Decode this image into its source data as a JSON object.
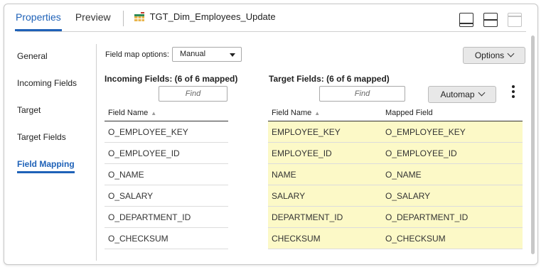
{
  "tabs": [
    {
      "label": "Properties",
      "active": true
    },
    {
      "label": "Preview",
      "active": false
    }
  ],
  "object_title": "TGT_Dim_Employees_Update",
  "nav": [
    {
      "label": "General",
      "active": false
    },
    {
      "label": "Incoming Fields",
      "active": false
    },
    {
      "label": "Target",
      "active": false
    },
    {
      "label": "Target Fields",
      "active": false
    },
    {
      "label": "Field Mapping",
      "active": true
    }
  ],
  "field_map_options": {
    "label": "Field map options:",
    "value": "Manual"
  },
  "options_button": "Options",
  "incoming": {
    "title": "Incoming Fields: (6 of 6 mapped)",
    "find_placeholder": "Find",
    "header": "Field Name",
    "rows": [
      "O_EMPLOYEE_KEY",
      "O_EMPLOYEE_ID",
      "O_NAME",
      "O_SALARY",
      "O_DEPARTMENT_ID",
      "O_CHECKSUM"
    ]
  },
  "target": {
    "title": "Target Fields: (6 of 6 mapped)",
    "find_placeholder": "Find",
    "automap_label": "Automap",
    "headers": {
      "field": "Field Name",
      "mapped": "Mapped Field"
    },
    "rows": [
      {
        "field": "EMPLOYEE_KEY",
        "mapped": "O_EMPLOYEE_KEY"
      },
      {
        "field": "EMPLOYEE_ID",
        "mapped": "O_EMPLOYEE_ID"
      },
      {
        "field": "NAME",
        "mapped": "O_NAME"
      },
      {
        "field": "SALARY",
        "mapped": "O_SALARY"
      },
      {
        "field": "DEPARTMENT_ID",
        "mapped": "O_DEPARTMENT_ID"
      },
      {
        "field": "CHECKSUM",
        "mapped": "O_CHECKSUM"
      }
    ]
  },
  "colors": {
    "accent": "#1f62b8",
    "mapped_row": "#fcf9c7"
  },
  "icons": {
    "object": "target-table-icon",
    "sort": "sort-ascending-icon"
  }
}
